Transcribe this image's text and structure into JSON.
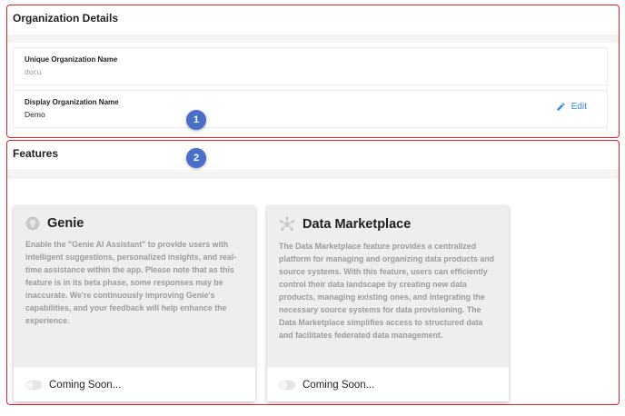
{
  "org_section": {
    "title": "Organization Details",
    "unique_name": {
      "label": "Unique Organization Name",
      "value": "docu"
    },
    "display_name": {
      "label": "Display Organization Name",
      "value": "Demo"
    },
    "edit_label": "Edit",
    "marker": "1"
  },
  "features_section": {
    "title": "Features",
    "marker": "2",
    "cards": [
      {
        "title": "Genie",
        "icon": "genie-icon",
        "description": "Enable the \"Genie AI Assistant\" to provide users with intelligent suggestions, personalized insights, and real-time assistance within the app. Please note that as this feature is in its beta phase, some responses may be inaccurate. We're continuously improving Genie's capabilities, and your feedback will help enhance the experience.",
        "status": "Coming Soon..."
      },
      {
        "title": "Data Marketplace",
        "icon": "data-marketplace-icon",
        "description": "The Data Marketplace feature provides a centralized platform for managing and organizing data products and source systems. With this feature, users can efficiently control their data landscape by creating new data products, managing existing ones, and integrating the necessary source systems for data provisioning. The Data Marketplace simplifies access to structured data and facilitates federated data management.",
        "status": "Coming Soon..."
      }
    ]
  },
  "colors": {
    "highlight_border": "#e0242a",
    "marker_bg": "#4a6fc9",
    "link": "#2b8be0"
  }
}
